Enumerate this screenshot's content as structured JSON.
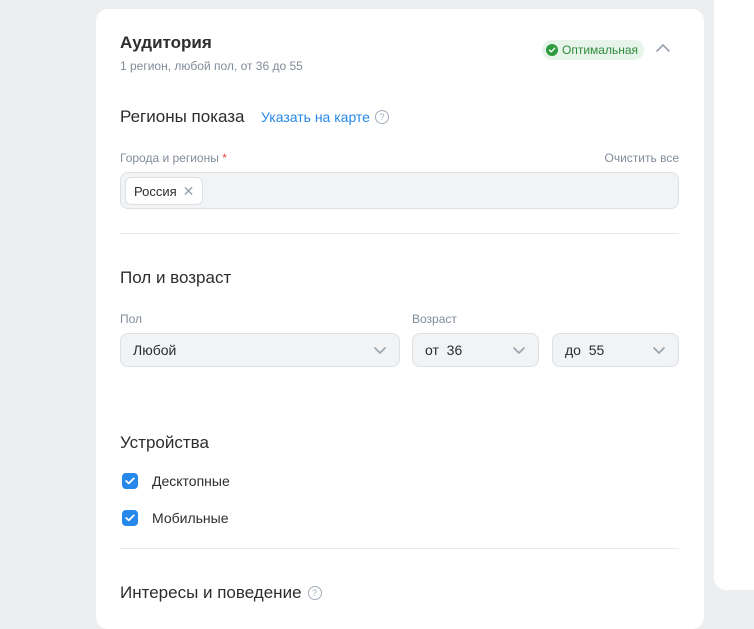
{
  "audience": {
    "title": "Аудитория",
    "subtitle": "1 регион, любой пол, от 36 до 55",
    "status_badge": "Оптимальная"
  },
  "regions": {
    "heading": "Регионы показа",
    "map_link": "Указать на карте",
    "help": "?",
    "field_label": "Города и регионы",
    "required_mark": "*",
    "clear_all": "Очистить все",
    "tokens": [
      {
        "label": "Россия"
      }
    ],
    "remove_glyph": "✕"
  },
  "gender_age": {
    "heading": "Пол и возраст",
    "gender_label": "Пол",
    "gender_value": "Любой",
    "age_label": "Возраст",
    "age_from": "от  36",
    "age_to": "до  55"
  },
  "devices": {
    "heading": "Устройства",
    "items": [
      {
        "label": "Десктопные",
        "checked": true
      },
      {
        "label": "Мобильные",
        "checked": true
      }
    ]
  },
  "interests": {
    "heading": "Интересы и поведение",
    "help": "?"
  },
  "colors": {
    "accent": "#2688eb",
    "badge_green": "#2e9c3f",
    "page_bg": "#edeef0"
  }
}
